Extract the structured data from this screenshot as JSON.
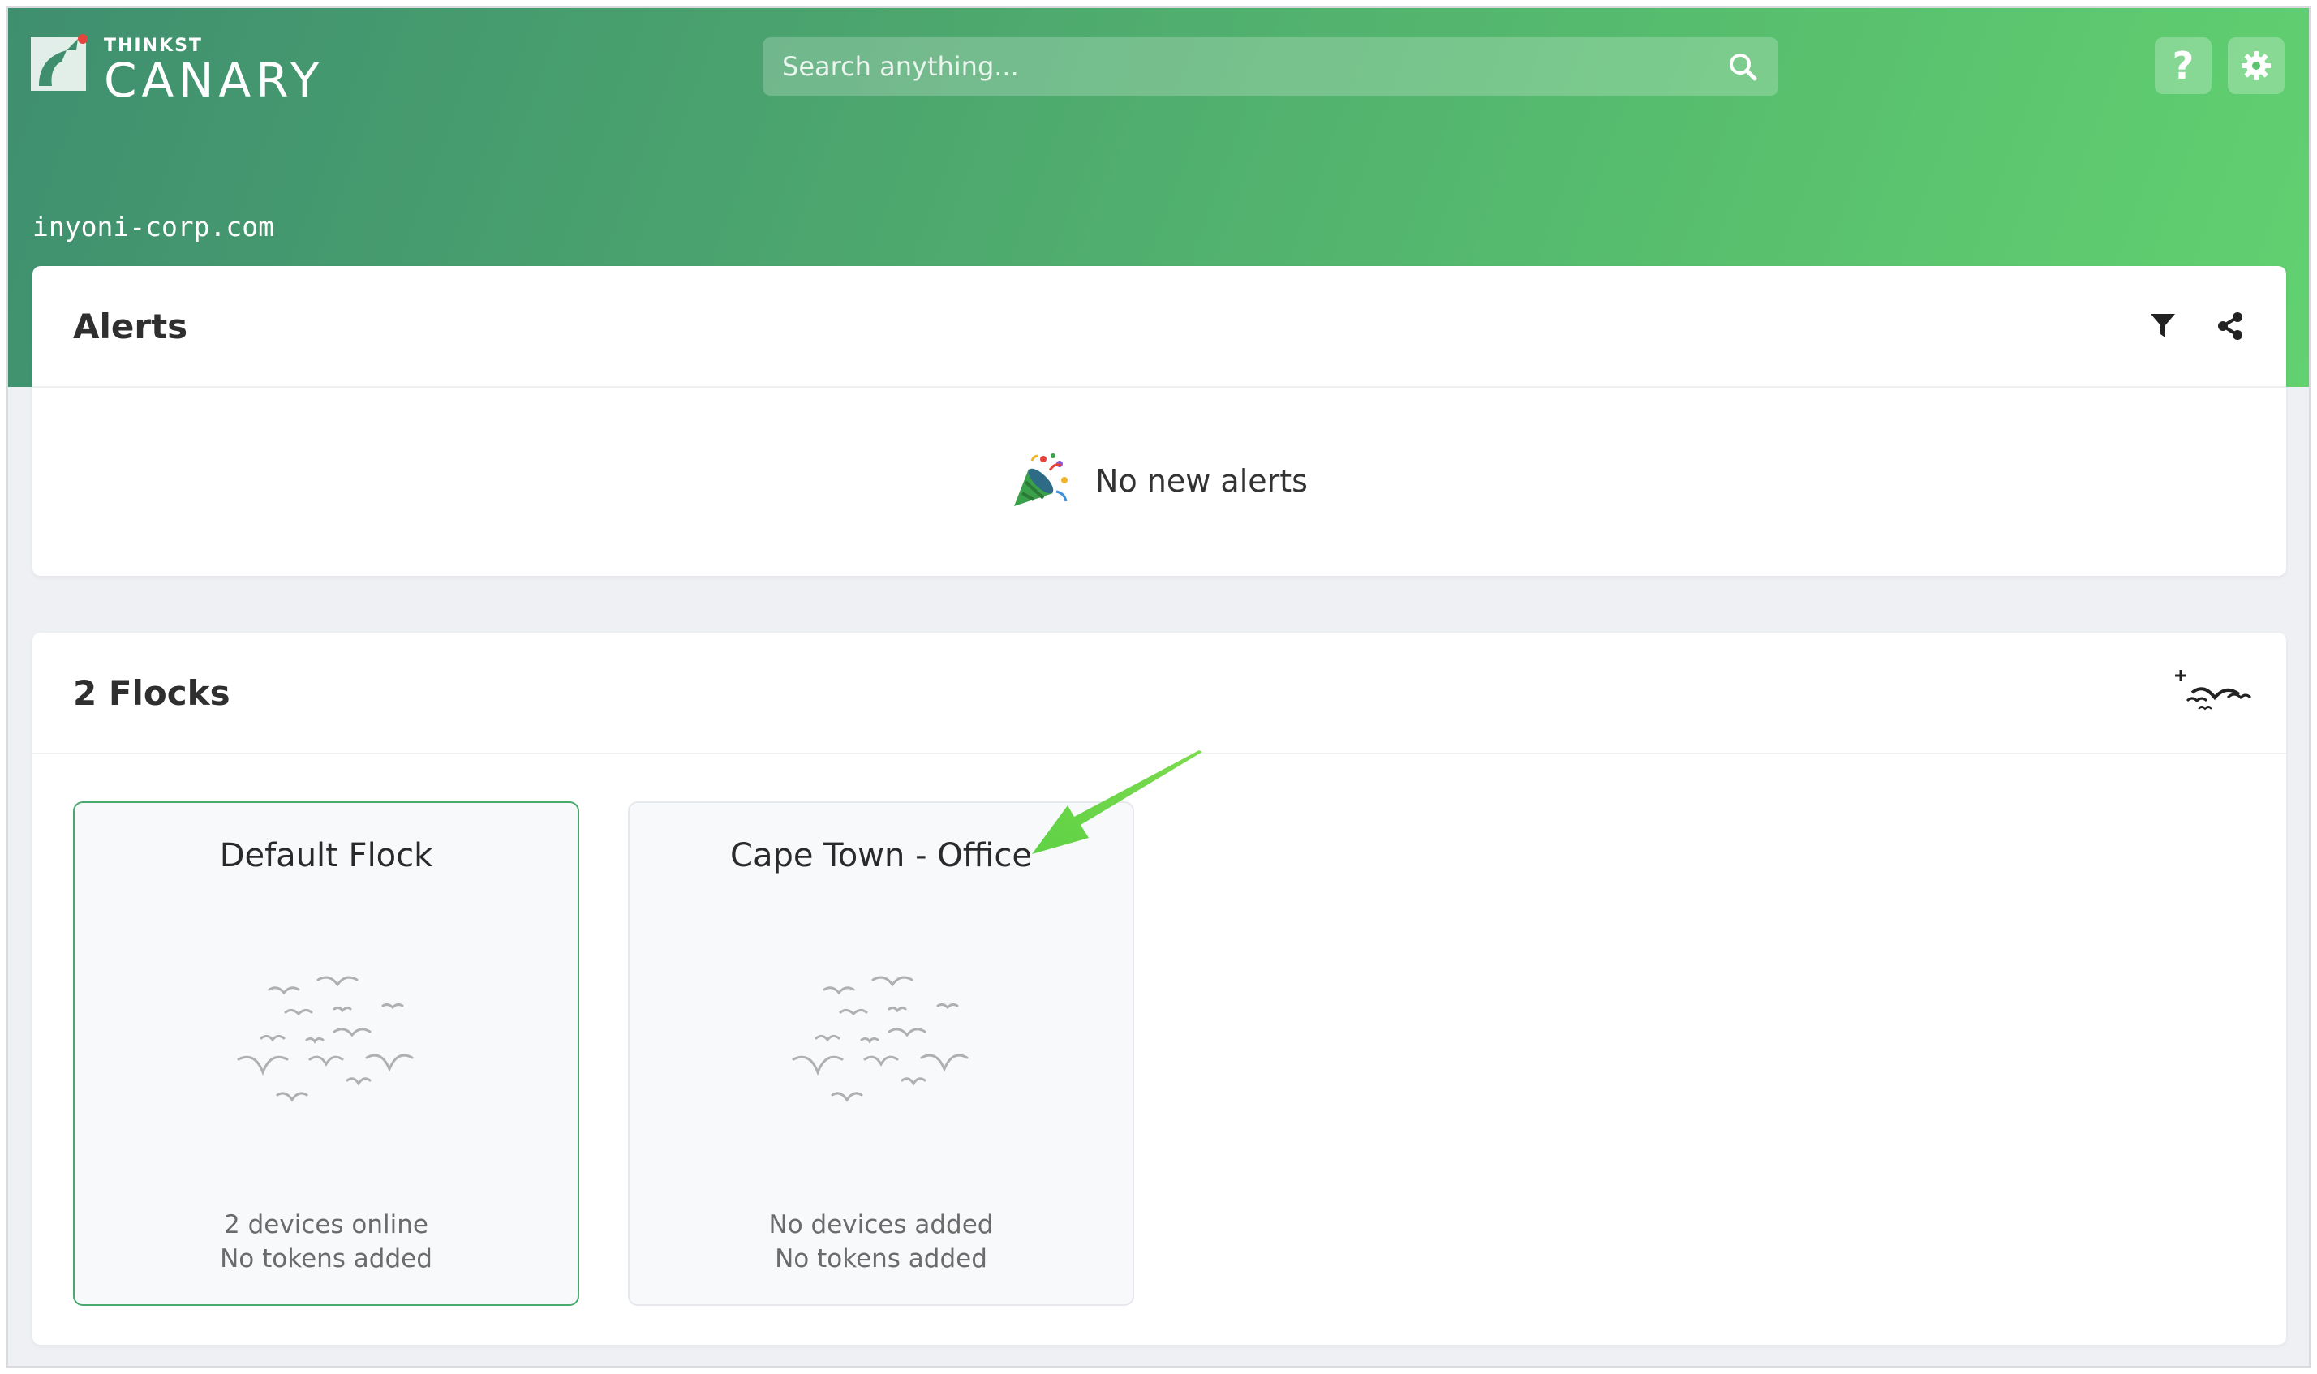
{
  "brand": {
    "small": "THINKST",
    "big": "CANARY"
  },
  "search": {
    "placeholder": "Search anything..."
  },
  "header_buttons": {
    "help": "?"
  },
  "domain": "inyoni-corp.com",
  "alerts": {
    "title": "Alerts",
    "empty_message": "No new alerts"
  },
  "flocks": {
    "title": "2 Flocks",
    "items": [
      {
        "name": "Default Flock",
        "line1": "2 devices online",
        "line2": "No tokens added",
        "selected": true
      },
      {
        "name": "Cape Town - Office",
        "line1": "No devices added",
        "line2": "No tokens added",
        "selected": false
      }
    ]
  },
  "colors": {
    "accent": "#4aaa6e",
    "header_start": "#3f8f6f",
    "header_end": "#62d170",
    "annotation_arrow": "#6fd44a"
  },
  "icons": {
    "search": "search-icon",
    "help": "question-icon",
    "settings": "gear-icon",
    "filter": "filter-icon",
    "share": "share-icon",
    "party": "party-popper-icon",
    "add_flock": "add-flock-icon",
    "flock": "birds-icon"
  }
}
